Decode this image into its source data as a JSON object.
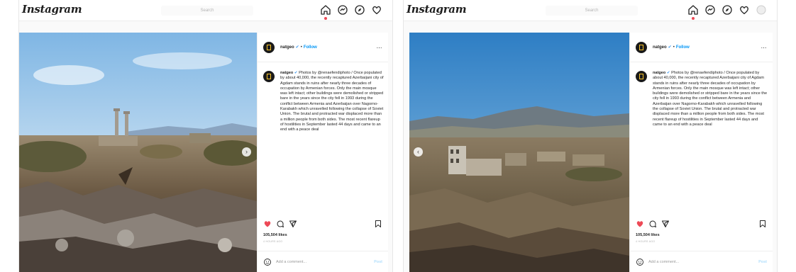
{
  "screens": {
    "left": {
      "app_name": "Instagram",
      "search_placeholder": "Search",
      "username": "natgeo",
      "verified_icon": "verified-badge-icon",
      "follow_label": "Follow",
      "more_label": "...",
      "caption_username": "natgeo",
      "caption_text": "Photos by @renaefendiphoto / Once populated by about 40,000, the recently recaptured Azerbaijani city of Agdam stands in ruins after nearly three decades of occupation by Armenian forces. Only the main mosque was left intact; other buildings were demolished or stripped bare in the years since the city fell in 1993 during the conflict between Armenia and Azerbaijan over Nagorno-Karabakh which unravelled following the collapse of Soviet Union. The brutal and protracted war displaced more than a million people from both sides. The most recent flareup of hostilities in September lasted 44 days and came to an end with a peace deal",
      "likes": "105,504 likes",
      "posted_ago": "4 HOURS AGO",
      "comment_placeholder": "Add a comment...",
      "post_label": "Post",
      "carousel_arrow": "›"
    },
    "right": {
      "app_name": "Instagram",
      "search_placeholder": "Search",
      "username": "natgeo",
      "verified_icon": "verified-badge-icon",
      "follow_label": "Follow",
      "more_label": "...",
      "caption_username": "natgeo",
      "caption_text": "Photos by @renaefendiphoto / Once populated by about 40,000, the recently recaptured Azerbaijani city of Agdam stands in ruins after nearly three decades of occupation by Armenian forces. Only the main mosque was left intact; other buildings were demolished or stripped bare in the years since the city fell in 1993 during the conflict between Armenia and Azerbaijan over Nagorno-Karabakh which unravelled following the collapse of Soviet Union. The brutal and protracted war displaced more than a million people from both sides. The most recent flareup of hostilities in September lasted 44 days and came to an end with a peace deal",
      "likes": "105,504 likes",
      "posted_ago": "4 HOURS AGO",
      "comment_placeholder": "Add a comment...",
      "post_label": "Post",
      "carousel_arrow": "‹"
    }
  },
  "icons": {
    "nav": [
      "home-icon",
      "messenger-icon",
      "explore-icon",
      "activity-heart-icon",
      "profile-icon"
    ],
    "actions": [
      "like-heart-icon",
      "comment-icon",
      "share-icon",
      "save-bookmark-icon"
    ],
    "emoji": "emoji-icon"
  },
  "colors": {
    "like_red": "#ed4956",
    "follow_blue": "#0095f6",
    "verified_blue": "#3897f0"
  }
}
